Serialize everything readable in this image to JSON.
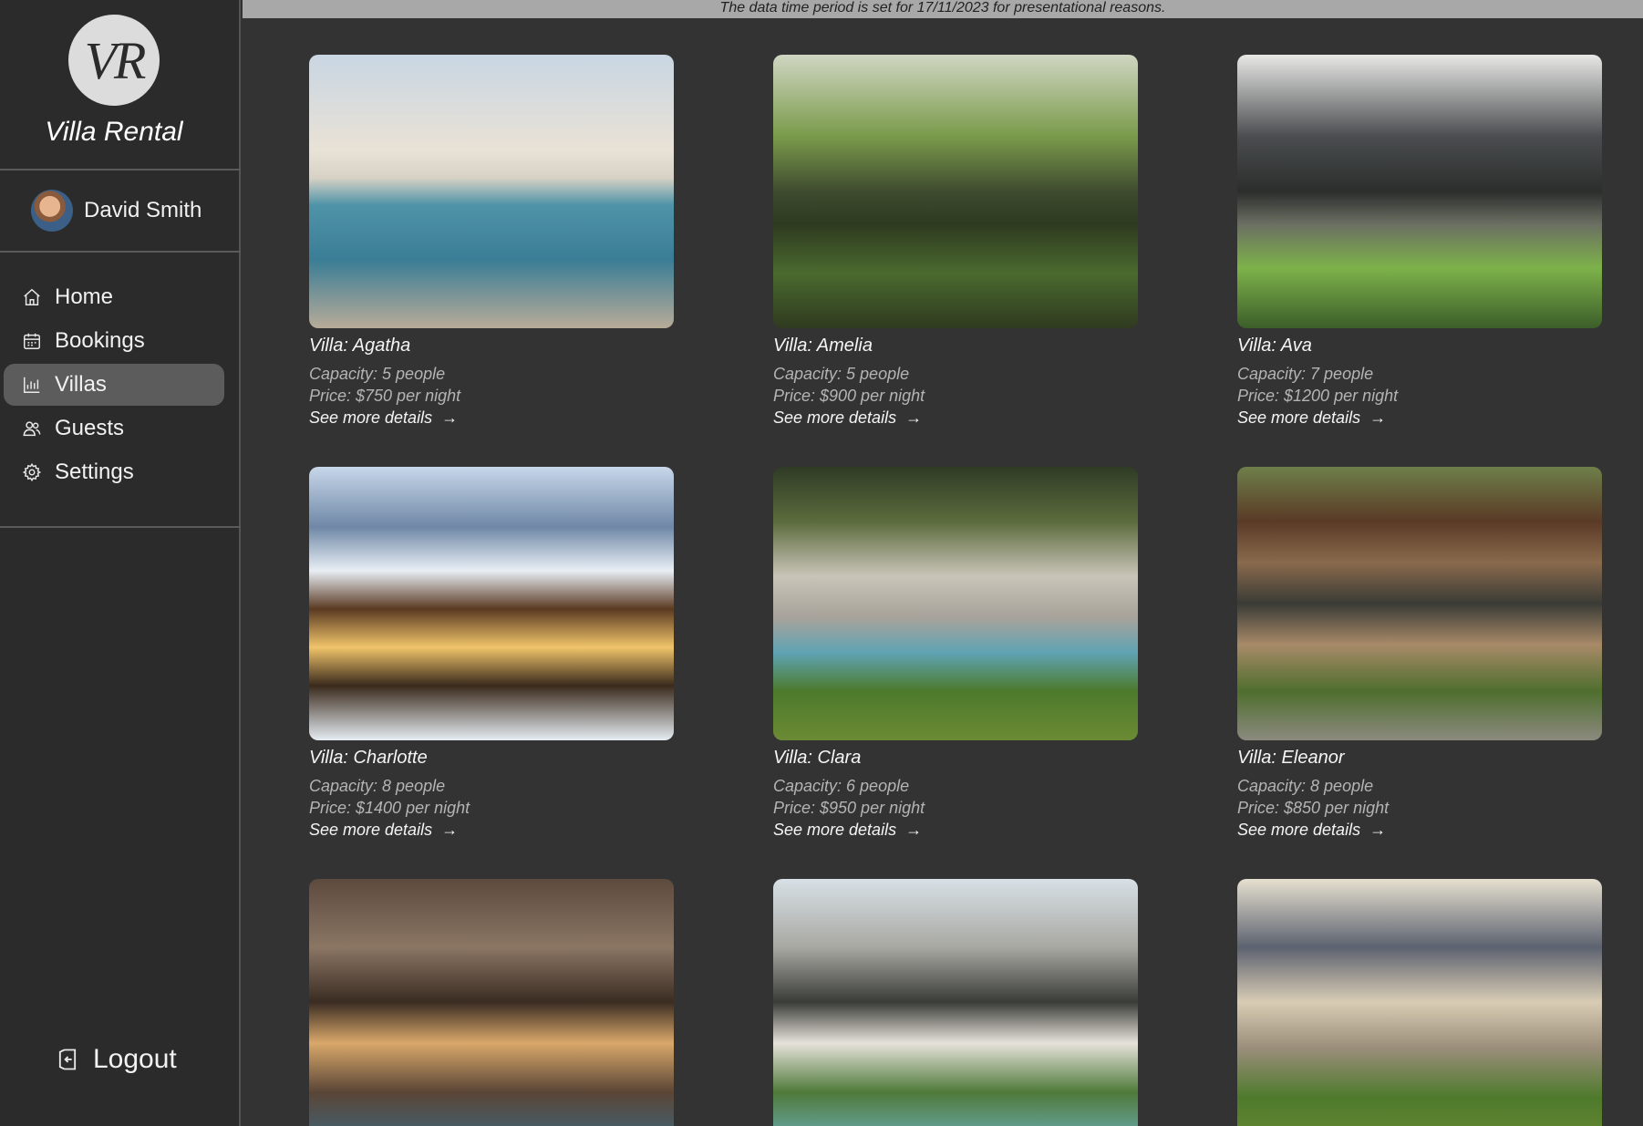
{
  "app": {
    "logo_text": "VR",
    "brand_name": "Villa Rental",
    "banner": "The data time period is set for 17/11/2023 for presentational reasons."
  },
  "user": {
    "name": "David Smith"
  },
  "nav": {
    "items": [
      {
        "label": "Home",
        "icon": "home-icon",
        "active": false
      },
      {
        "label": "Bookings",
        "icon": "calendar-icon",
        "active": false
      },
      {
        "label": "Villas",
        "icon": "chart-icon",
        "active": true
      },
      {
        "label": "Guests",
        "icon": "users-icon",
        "active": false
      },
      {
        "label": "Settings",
        "icon": "gear-icon",
        "active": false
      }
    ],
    "logout_label": "Logout"
  },
  "villas": [
    {
      "name": "Villa: Agatha",
      "capacity": "Capacity: 5 people",
      "price": "Price: $750 per night",
      "details": "See more details"
    },
    {
      "name": "Villa: Amelia",
      "capacity": "Capacity: 5 people",
      "price": "Price: $900 per night",
      "details": "See more details"
    },
    {
      "name": "Villa: Ava",
      "capacity": "Capacity: 7 people",
      "price": "Price: $1200 per night",
      "details": "See more details"
    },
    {
      "name": "Villa: Charlotte",
      "capacity": "Capacity: 8 people",
      "price": "Price: $1400 per night",
      "details": "See more details"
    },
    {
      "name": "Villa: Clara",
      "capacity": "Capacity: 6 people",
      "price": "Price: $950 per night",
      "details": "See more details"
    },
    {
      "name": "Villa: Eleanor",
      "capacity": "Capacity: 8 people",
      "price": "Price: $850 per night",
      "details": "See more details"
    }
  ],
  "arrow_glyph": "→"
}
